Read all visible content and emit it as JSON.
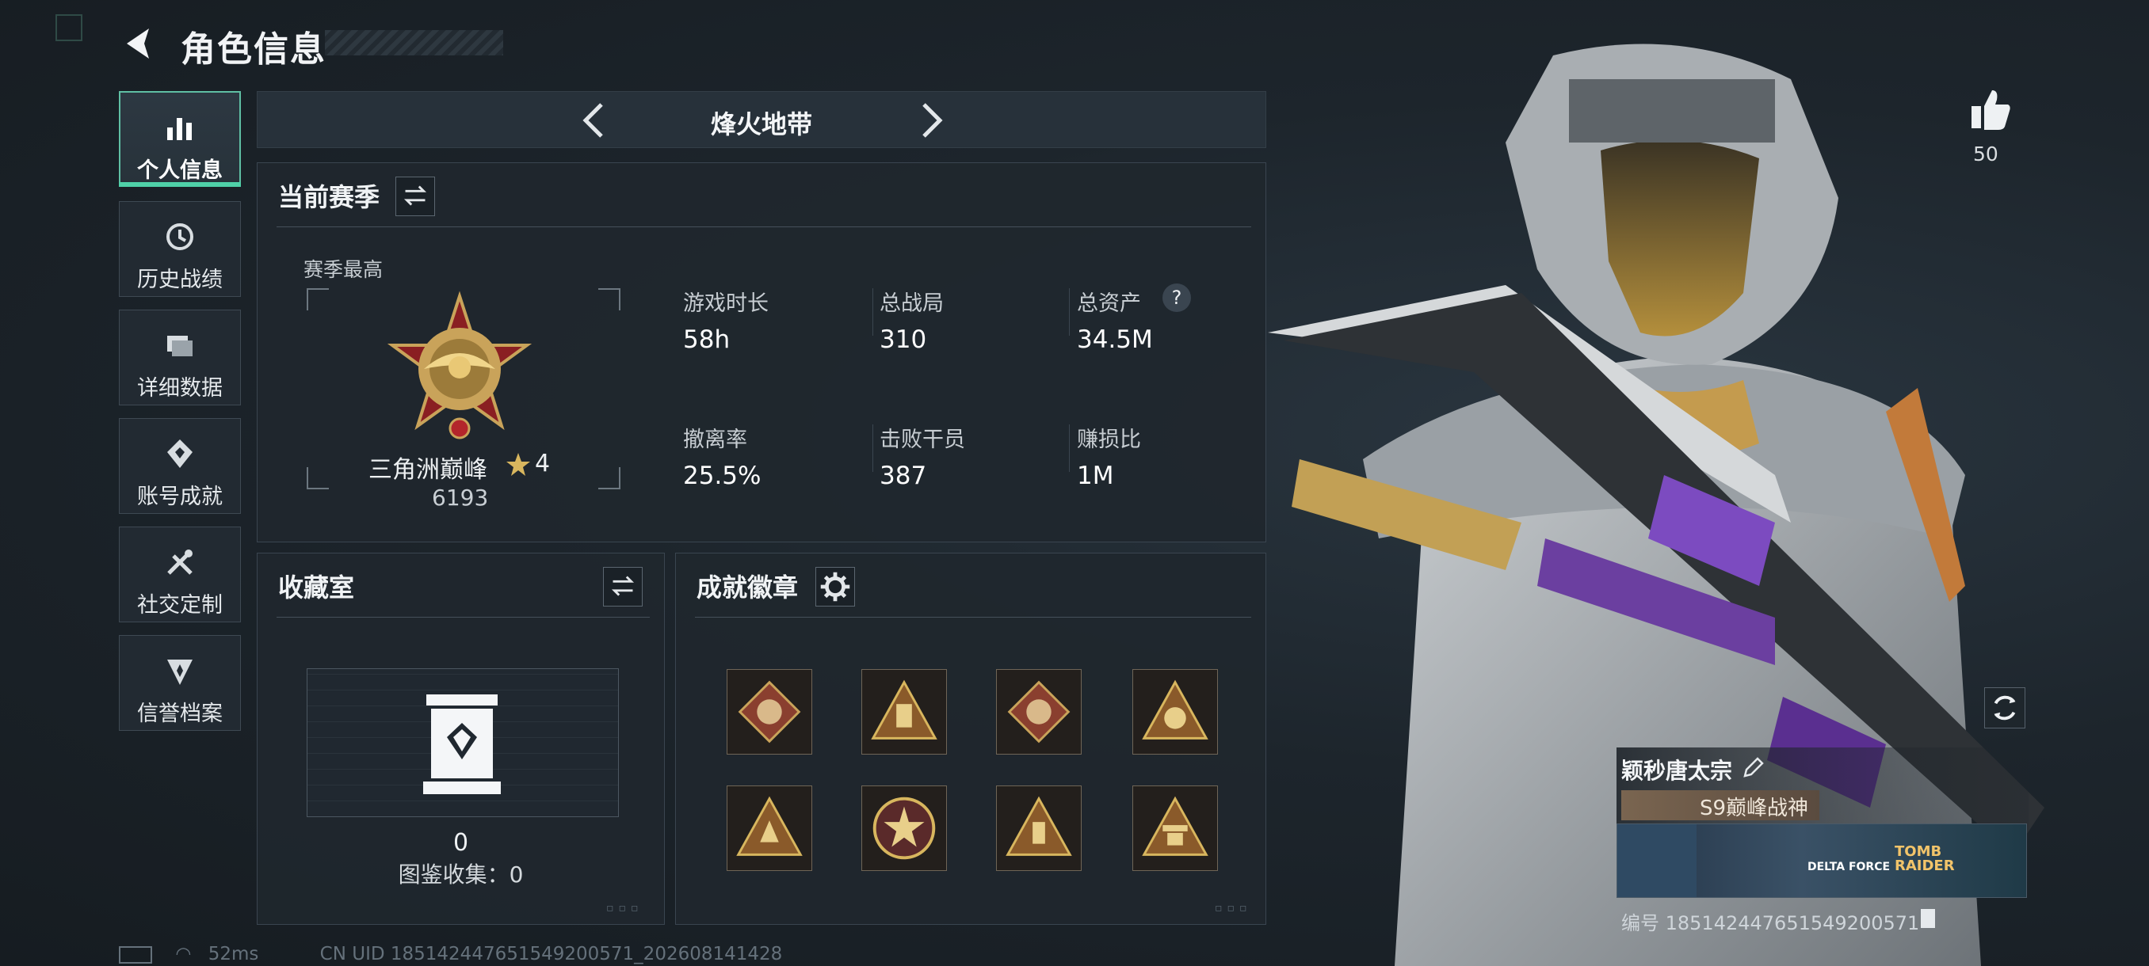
{
  "header": {
    "title": "角色信息"
  },
  "sidebar": {
    "items": [
      {
        "label": "个人信息",
        "icon": "bar-chart-icon",
        "active": true
      },
      {
        "label": "历史战绩",
        "icon": "history-icon",
        "active": false
      },
      {
        "label": "详细数据",
        "icon": "folder-icon",
        "active": false
      },
      {
        "label": "账号成就",
        "icon": "badge-icon",
        "active": false
      },
      {
        "label": "社交定制",
        "icon": "tools-icon",
        "active": false
      },
      {
        "label": "信誉档案",
        "icon": "shield-icon",
        "active": false
      }
    ]
  },
  "mode": {
    "title": "烽火地带"
  },
  "season": {
    "title": "当前赛季",
    "peak_label": "赛季最高",
    "rank_name": "三角洲巅峰",
    "rank_stars": "4",
    "rank_score": "6193",
    "stats": [
      {
        "label": "游戏时长",
        "value": "58h"
      },
      {
        "label": "总战局",
        "value": "310"
      },
      {
        "label": "总资产",
        "value": "34.5M"
      },
      {
        "label": "撤离率",
        "value": "25.5%"
      },
      {
        "label": "击败干员",
        "value": "387"
      },
      {
        "label": "赚损比",
        "value": "1M"
      }
    ],
    "help_symbol": "?"
  },
  "collection": {
    "title": "收藏室",
    "count": "0",
    "caption": "图鉴收集：0"
  },
  "badges": {
    "title": "成就徽章",
    "count": 8
  },
  "profile": {
    "likes": "50",
    "name": "颖秒唐太宗",
    "rank_title": "S9巅峰战神",
    "banner_text_1": "DELTA FORCE",
    "banner_text_2": "TOMB RAIDER",
    "id_line": "编号 185142447651549200571"
  },
  "status": {
    "ping": "52ms",
    "uid_line": "CN UID 185142447651549200571_202608141428"
  },
  "colors": {
    "accent": "#4fd1a8",
    "panel": "#1f272e",
    "background": "#1b2229",
    "gold": "#c9a35a"
  }
}
